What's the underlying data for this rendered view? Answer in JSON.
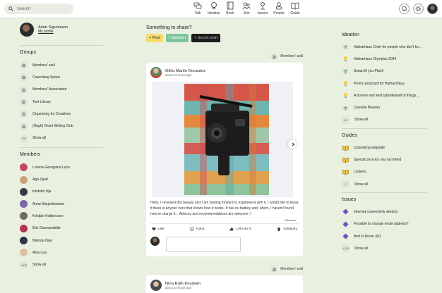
{
  "topbar": {
    "search_placeholder": "Search",
    "nav": [
      {
        "label": "Talk",
        "icon": "talk-icon"
      },
      {
        "label": "Ideation",
        "icon": "lightbulb-icon"
      },
      {
        "label": "Book",
        "icon": "book-icon"
      },
      {
        "label": "Join",
        "icon": "people-icon"
      },
      {
        "label": "Issues",
        "icon": "wrench-icon"
      },
      {
        "label": "People",
        "icon": "person-icon"
      },
      {
        "label": "Guide",
        "icon": "open-book-icon"
      }
    ]
  },
  "profile": {
    "name": "Amar Sigurdsson",
    "link": "My profile"
  },
  "groups": {
    "title": "Groups",
    "items": [
      "Members' wall",
      "Coworking Space",
      "Members' Association",
      "Tool Library",
      "Organizing for Creatives",
      "(Hugh) Grant Writing Club"
    ],
    "show_all_count": "+29",
    "show_all": "Show all"
  },
  "members": {
    "title": "Members",
    "items": [
      "Lorena-Georgiana Luca",
      "Aga Zgud",
      "kristofer lilja",
      "Anna Marjankowska",
      "Kristján Hafþórsson",
      "Elio Gunnarsdóttir",
      "Belinda Navi",
      "Alda Loa"
    ],
    "show_all_count": "+403",
    "show_all": "Show all"
  },
  "share": {
    "title": "Something to share?",
    "post": "+ Post",
    "ideation": "+ Ideation",
    "secret": "+ Secret wish"
  },
  "feed_tag": "Members' wall",
  "post": {
    "author": "Otilia Martin Gonzalez",
    "time": "about 19 hours ago",
    "text": "Hello, I received this beauty and I am looking forward to experiment with it. I would like to know if there is anyone here that knows how it works. It has no battery and, ahem, I haven't found how to charge it... Advices and recommendations are welcome :)",
    "remove": "Remove",
    "reactions": [
      "Like",
      "Haha",
      "Let's do it!",
      "Solidarity"
    ]
  },
  "post2": {
    "author": "Nina Ruth Knudsen",
    "time": "about 22 hours ago"
  },
  "ideation": {
    "title": "Ideation",
    "items": [
      "Hafnarhaus Choir for people who don't kn...",
      "Hafnarhaus Olympics 2024",
      "Swap till you Plant!",
      "Promo postcard for Hafnar.Haus",
      "A borrow and lend tab/site/wall of things ...",
      "Console Heaven"
    ],
    "show_all_count": "+17",
    "show_all": "Show all"
  },
  "guides": {
    "title": "Guides",
    "items": [
      "Coworking etiquette",
      "Special price for you my friend",
      "Lockers"
    ],
    "show_all_count": "+7",
    "show_all": "Show all"
  },
  "issues": {
    "title": "Issues",
    "items": [
      "Internet connectivity sketchy",
      "Possible to change email address?",
      "Bird in Room 301"
    ],
    "show_all_count": "+143",
    "show_all": "Show all"
  },
  "colors": {
    "background": "#eaf0e0",
    "post_button": "#f6dc6c",
    "ideation_button": "#7dc69a",
    "secret_button": "#1c1c1c"
  }
}
